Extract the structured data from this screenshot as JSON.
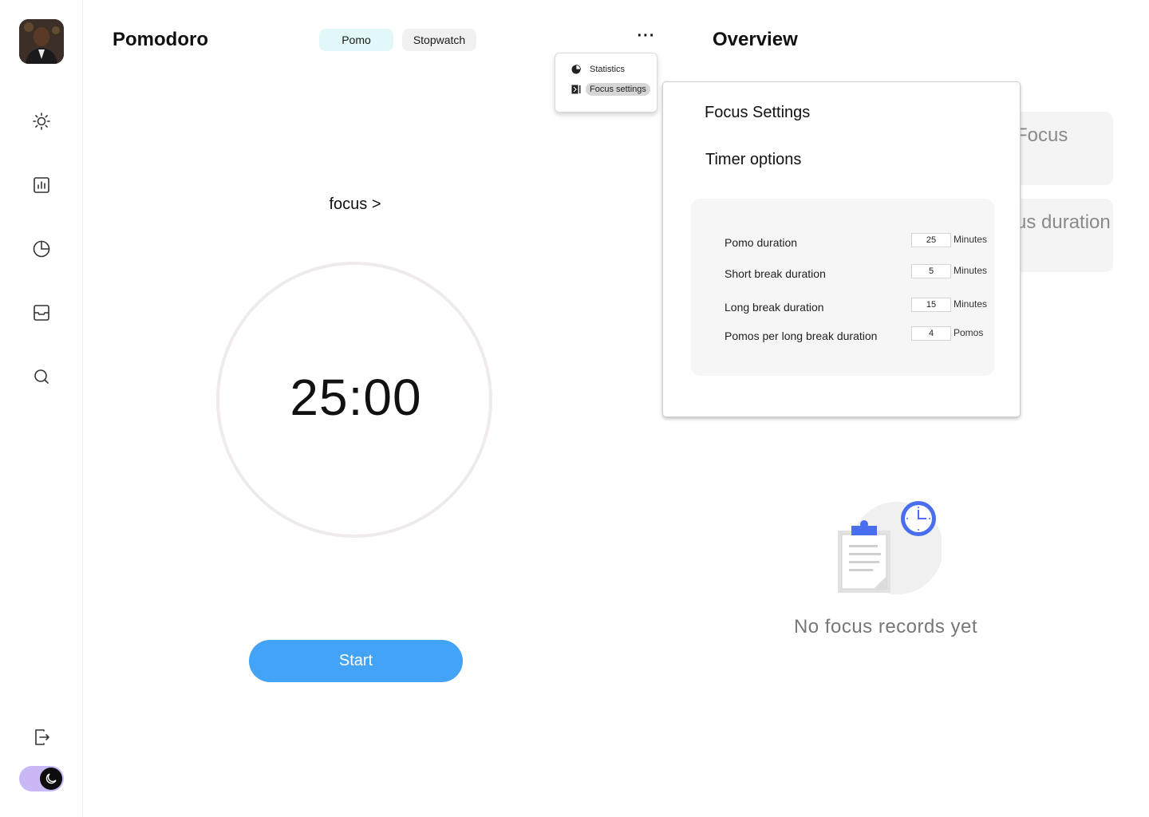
{
  "sidebar": {
    "avatar": "user-avatar",
    "items": [
      {
        "name": "sun-icon"
      },
      {
        "name": "bar-chart-icon"
      },
      {
        "name": "pie-chart-icon"
      },
      {
        "name": "inbox-icon"
      },
      {
        "name": "search-icon"
      }
    ],
    "logout": "logout-icon",
    "theme_toggle": {
      "mode": "dark",
      "icon": "moon-icon"
    }
  },
  "header": {
    "title": "Pomodoro",
    "tabs": [
      {
        "label": "Pomo",
        "active": true
      },
      {
        "label": "Stopwatch",
        "active": false
      }
    ],
    "more_label": "···"
  },
  "menu": {
    "items": [
      {
        "label": "Statistics",
        "icon": "pie-icon"
      },
      {
        "label": "Focus settings",
        "icon": "focus-icon",
        "active": true
      }
    ]
  },
  "timer": {
    "mode_label": "focus >",
    "time": "25:00",
    "start_label": "Start"
  },
  "overview": {
    "title": "Overview",
    "cards": [
      {
        "text": "Focus"
      },
      {
        "text": "us duration"
      }
    ],
    "empty_text": "No focus records yet"
  },
  "focus_settings": {
    "title": "Focus Settings",
    "subtitle": "Timer options",
    "options": [
      {
        "label": "Pomo duration",
        "value": "25",
        "unit": "Minutes"
      },
      {
        "label": "Short break duration",
        "value": "5",
        "unit": "Minutes"
      },
      {
        "label": "Long break duration",
        "value": "15",
        "unit": "Minutes"
      },
      {
        "label": "Pomos per long break duration",
        "value": "4",
        "unit": "Pomos"
      }
    ]
  },
  "colors": {
    "accent": "#43a3f7",
    "tab_active": "#e2f8f8",
    "toggle": "#c9b8f5",
    "illustration_blue": "#4a6ef0"
  }
}
